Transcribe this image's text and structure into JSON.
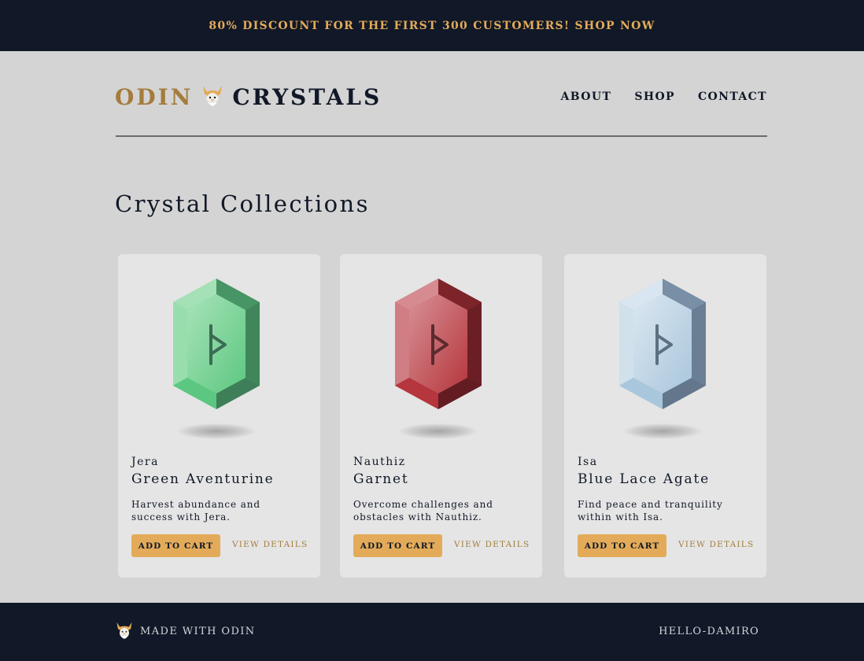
{
  "banner": {
    "text": "80% DISCOUNT FOR THE FIRST 300 CUSTOMERS! SHOP NOW"
  },
  "header": {
    "logo_left": "ODIN",
    "logo_right": "CRYSTALS",
    "nav": [
      "ABOUT",
      "SHOP",
      "CONTACT"
    ]
  },
  "main": {
    "title": "Crystal Collections",
    "cards": [
      {
        "rune": "Jera",
        "name": "Green Aventurine",
        "description": "Harvest abundance and success with Jera.",
        "add_label": "ADD TO CART",
        "details_label": "VIEW DETAILS",
        "colors": {
          "light": "#a8e3b8",
          "mid": "#5cc781",
          "dark": "#3c7a55",
          "rune": "#3b6b55"
        }
      },
      {
        "rune": "Nauthiz",
        "name": "Garnet",
        "description": "Overcome challenges and obstacles with Nauthiz.",
        "add_label": "ADD TO CART",
        "details_label": "VIEW DETAILS",
        "colors": {
          "light": "#d79095",
          "mid": "#b5363c",
          "dark": "#5e1b21",
          "rune": "#5a2a2e"
        }
      },
      {
        "rune": "Isa",
        "name": "Blue Lace Agate",
        "description": "Find peace and tranquility within with Isa.",
        "add_label": "ADD TO CART",
        "details_label": "VIEW DETAILS",
        "colors": {
          "light": "#dbe7f0",
          "mid": "#a9c6dc",
          "dark": "#5f7287",
          "rune": "#5b7082"
        }
      }
    ]
  },
  "footer": {
    "made_with": "MADE WITH ODIN",
    "credit": "HELLO-DAMIRO"
  },
  "colors": {
    "navy": "#111827",
    "gold": "#e3ab59",
    "gold_dark": "#a47c3d",
    "page_bg": "#d4d4d4",
    "card_bg": "#e5e5e5"
  }
}
